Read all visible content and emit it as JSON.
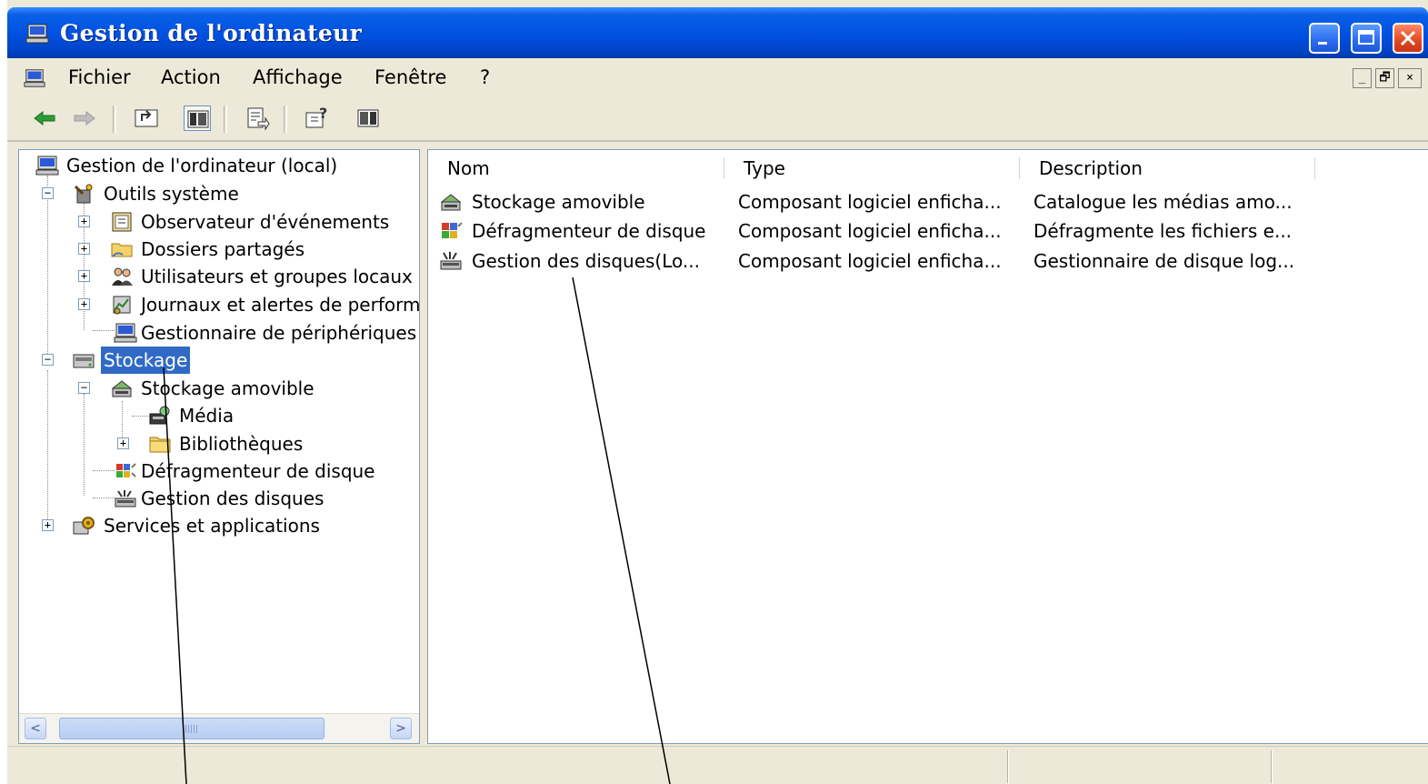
{
  "window": {
    "title": "Gestion de l'ordinateur",
    "controls": [
      "minimize-icon",
      "maximize-icon",
      "close-icon"
    ]
  },
  "menubar": {
    "items": [
      "Fichier",
      "Action",
      "Affichage",
      "Fenêtre",
      "?"
    ],
    "mdi_controls": [
      "_",
      "🗗",
      "×"
    ]
  },
  "toolbar": {
    "buttons": [
      "back-icon",
      "forward-icon",
      "up-folder-icon",
      "show-hide-tree-icon",
      "export-list-icon",
      "help-icon",
      "show-hide-action-pane-icon"
    ]
  },
  "tree": {
    "root": "Gestion de l'ordinateur (local)",
    "items": [
      {
        "label": "Outils système",
        "expander": "−"
      },
      {
        "label": "Observateur d'événements",
        "expander": "+"
      },
      {
        "label": "Dossiers partagés",
        "expander": "+"
      },
      {
        "label": "Utilisateurs et groupes locaux",
        "expander": "+"
      },
      {
        "label": "Journaux et alertes de performance",
        "expander": "+"
      },
      {
        "label": "Gestionnaire de périphériques",
        "expander": ""
      },
      {
        "label": "Stockage",
        "expander": "−",
        "selected": true
      },
      {
        "label": "Stockage amovible",
        "expander": "−"
      },
      {
        "label": "Média",
        "expander": ""
      },
      {
        "label": "Bibliothèques",
        "expander": "+"
      },
      {
        "label": "Défragmenteur de disque",
        "expander": ""
      },
      {
        "label": "Gestion des disques",
        "expander": ""
      },
      {
        "label": "Services et applications",
        "expander": "+"
      }
    ],
    "scrollbar": {
      "left_arrow": "<",
      "right_arrow": ">"
    }
  },
  "list": {
    "columns": [
      "Nom",
      "Type",
      "Description"
    ],
    "rows": [
      {
        "nom": "Stockage amovible",
        "type": "Composant logiciel enficha...",
        "description": "Catalogue les médias amo..."
      },
      {
        "nom": "Défragmenteur de disque",
        "type": "Composant logiciel enficha...",
        "description": "Défragmente les fichiers e..."
      },
      {
        "nom": "Gestion des disques(Lo...",
        "type": "Composant logiciel enficha...",
        "description": "Gestionnaire de disque log..."
      }
    ]
  },
  "colors": {
    "titlebar": "#0050e0",
    "selection": "#316ac5",
    "window_bg": "#ece9d8"
  }
}
